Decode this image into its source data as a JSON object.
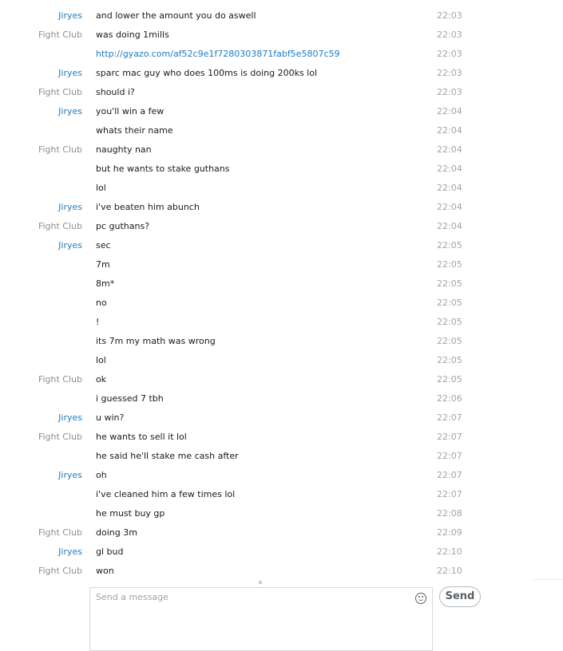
{
  "colors": {
    "self_name": "#1e7bc2",
    "other_name": "#8a8f94",
    "link": "#1e7bc2",
    "time": "#a0a4a8"
  },
  "messages": [
    {
      "sender": "Jiryes",
      "text": "and lower the amount you do aswell",
      "time": "22:03"
    },
    {
      "sender": "Fight Club",
      "text": "was doing 1mills",
      "time": "22:03"
    },
    {
      "sender": "",
      "text": "http://gyazo.com/af52c9e1f7280303871fabf5e5807c59",
      "time": "22:03",
      "link": true
    },
    {
      "sender": "Jiryes",
      "text": "sparc mac guy who does 100ms is doing 200ks lol",
      "time": "22:03"
    },
    {
      "sender": "Fight Club",
      "text": "should i?",
      "time": "22:03"
    },
    {
      "sender": "Jiryes",
      "text": "you'll win a few",
      "time": "22:04"
    },
    {
      "sender": "",
      "text": "whats their name",
      "time": "22:04"
    },
    {
      "sender": "Fight Club",
      "text": "naughty nan",
      "time": "22:04"
    },
    {
      "sender": "",
      "text": "but he wants to stake guthans",
      "time": "22:04"
    },
    {
      "sender": "",
      "text": "lol",
      "time": "22:04"
    },
    {
      "sender": "Jiryes",
      "text": "i've beaten him abunch",
      "time": "22:04"
    },
    {
      "sender": "Fight Club",
      "text": "pc guthans?",
      "time": "22:04"
    },
    {
      "sender": "Jiryes",
      "text": "sec",
      "time": "22:05"
    },
    {
      "sender": "",
      "text": "7m",
      "time": "22:05"
    },
    {
      "sender": "",
      "text": "8m*",
      "time": "22:05"
    },
    {
      "sender": "",
      "text": "no",
      "time": "22:05"
    },
    {
      "sender": "",
      "text": "!",
      "time": "22:05"
    },
    {
      "sender": "",
      "text": "its 7m my math was wrong",
      "time": "22:05"
    },
    {
      "sender": "",
      "text": "lol",
      "time": "22:05"
    },
    {
      "sender": "Fight Club",
      "text": "ok",
      "time": "22:05"
    },
    {
      "sender": "",
      "text": "i guessed 7 tbh",
      "time": "22:06"
    },
    {
      "sender": "Jiryes",
      "text": "u win?",
      "time": "22:07"
    },
    {
      "sender": "Fight Club",
      "text": "he wants to sell it lol",
      "time": "22:07"
    },
    {
      "sender": "",
      "text": "he said he'll stake me cash after",
      "time": "22:07"
    },
    {
      "sender": "Jiryes",
      "text": "oh",
      "time": "22:07"
    },
    {
      "sender": "",
      "text": "i've cleaned him a few times lol",
      "time": "22:07"
    },
    {
      "sender": "",
      "text": "he must buy gp",
      "time": "22:08"
    },
    {
      "sender": "Fight Club",
      "text": "doing 3m",
      "time": "22:09"
    },
    {
      "sender": "Jiryes",
      "text": "gl bud",
      "time": "22:10"
    },
    {
      "sender": "Fight Club",
      "text": "won",
      "time": "22:10"
    }
  ],
  "compose": {
    "placeholder": "Send a message",
    "send_label": "Send"
  }
}
